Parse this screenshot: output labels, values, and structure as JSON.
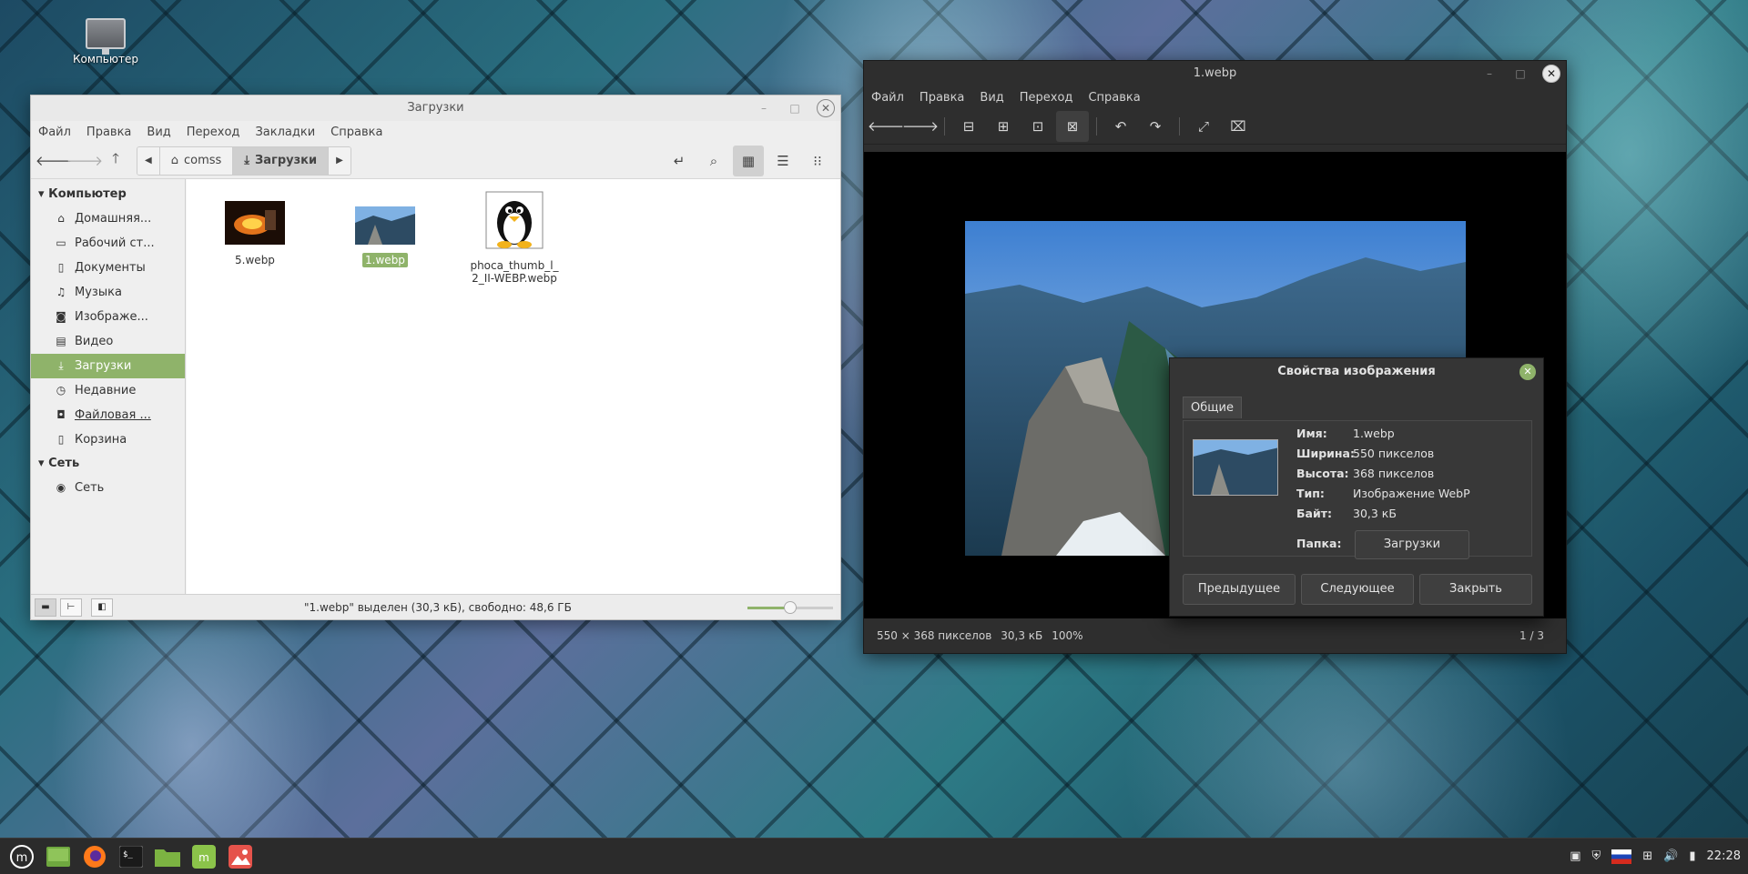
{
  "desktop": {
    "computer_label": "Компьютер"
  },
  "file_manager": {
    "title": "Загрузки",
    "menu": [
      "Файл",
      "Правка",
      "Вид",
      "Переход",
      "Закладки",
      "Справка"
    ],
    "breadcrumbs": [
      {
        "label": "comss",
        "icon": "home-icon"
      },
      {
        "label": "Загрузки",
        "icon": "download-icon"
      }
    ],
    "sidebar": {
      "section_computer": "Компьютер",
      "items": [
        {
          "label": "Домашняя...",
          "icon": "home-icon"
        },
        {
          "label": "Рабочий ст...",
          "icon": "desktop-icon"
        },
        {
          "label": "Документы",
          "icon": "document-icon"
        },
        {
          "label": "Музыка",
          "icon": "music-icon"
        },
        {
          "label": "Изображе...",
          "icon": "camera-icon"
        },
        {
          "label": "Видео",
          "icon": "video-icon"
        },
        {
          "label": "Загрузки",
          "icon": "download-icon",
          "selected": true
        },
        {
          "label": "Недавние",
          "icon": "recent-icon"
        },
        {
          "label": "Файловая ...",
          "icon": "drive-icon"
        },
        {
          "label": "Корзина",
          "icon": "trash-icon"
        }
      ],
      "section_network": "Сеть",
      "network_items": [
        {
          "label": "Сеть",
          "icon": "network-icon"
        }
      ]
    },
    "files": [
      {
        "name": "5.webp",
        "selected": false
      },
      {
        "name": "1.webp",
        "selected": true
      },
      {
        "name_line1": "phoca_thumb_l_",
        "name_line2": "2_II-WEBP.webp",
        "selected": false
      }
    ],
    "status": "\"1.webp\" выделен (30,3 кБ), свободно: 48,6 ГБ",
    "zoom_level": 0.5
  },
  "viewer": {
    "title": "1.webp",
    "menu": [
      "Файл",
      "Правка",
      "Вид",
      "Переход",
      "Справка"
    ],
    "status_dims": "550 × 368 пикселов",
    "status_size": "30,3 кБ",
    "status_zoom": "100%",
    "status_page": "1 / 3"
  },
  "properties": {
    "title": "Свойства изображения",
    "tab": "Общие",
    "name_key": "Имя:",
    "name_val": "1.webp",
    "width_key": "Ширина:",
    "width_val": "550 пикселов",
    "height_key": "Высота:",
    "height_val": "368 пикселов",
    "type_key": "Тип:",
    "type_val": "Изображение WebP",
    "bytes_key": "Байт:",
    "bytes_val": "30,3 кБ",
    "folder_key": "Папка:",
    "folder_val": "Загрузки",
    "btn_prev": "Предыдущее",
    "btn_next": "Следующее",
    "btn_close": "Закрыть"
  },
  "panel": {
    "time": "22:28",
    "accent": "#8fb36a"
  }
}
